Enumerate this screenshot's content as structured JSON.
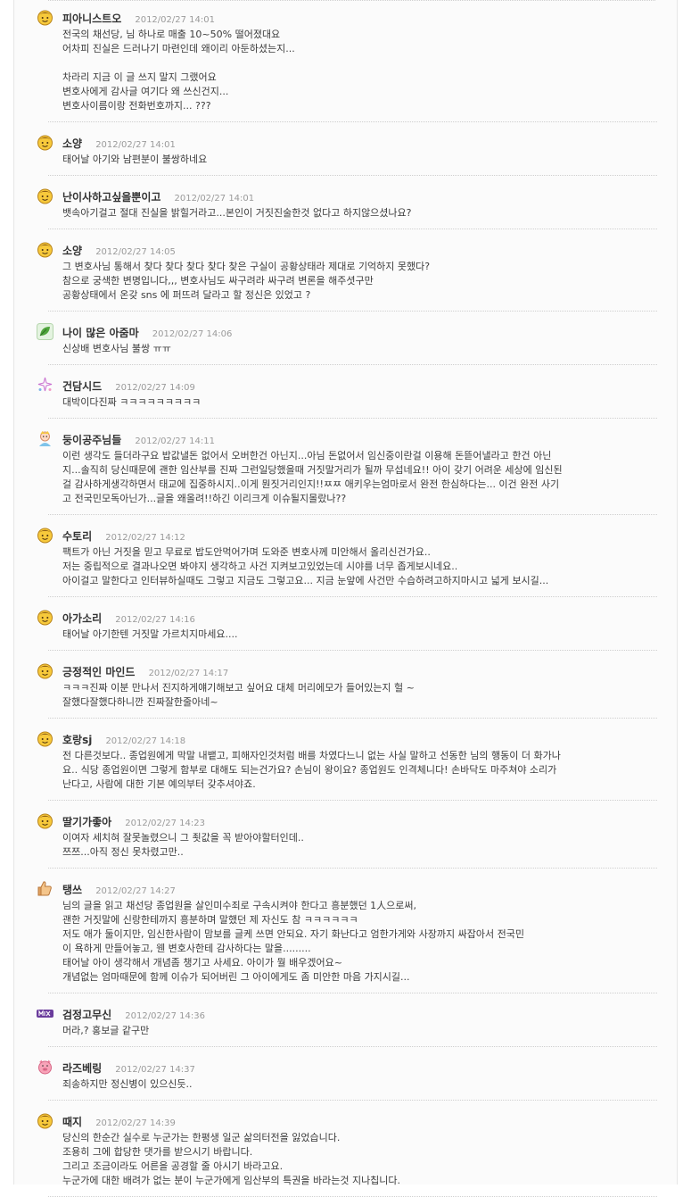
{
  "comments": [
    {
      "avatar": "smiley-face-icon",
      "name": "피아니스트오",
      "date": "2012/02/27 14:01",
      "lines": [
        "전국의 채선당, 님 하나로 매출 10~50% 떨어졌대요",
        "어차피 진실은 드러나기 마련인데 왜이리 아둔하셨는지...",
        "",
        "차라리 지금 이 글 쓰지 말지 그랬어요",
        "변호사에게 감사글 여기다 왜 쓰신건지...",
        "변호사이름이랑 전화번호까지... ???"
      ]
    },
    {
      "avatar": "smiley-face-icon",
      "name": "소양",
      "date": "2012/02/27 14:01",
      "lines": [
        "태어날 아기와 남편분이 불쌍하네요"
      ]
    },
    {
      "avatar": "smiley-face-icon",
      "name": "난이사하고싶을뿐이고",
      "date": "2012/02/27 14:01",
      "lines": [
        "뱃속아기걸고 절대 진실을 밝힐거라고...본인이 거짓진술한것 없다고 하지않으셨나요?"
      ]
    },
    {
      "avatar": "smiley-face-icon",
      "name": "소양",
      "date": "2012/02/27 14:05",
      "lines": [
        "그 변호사님 통해서 찾다 찾다 찾다 찾다 찾은 구실이 공황상태라 제대로 기억하지 못했다?",
        "참으로 궁색한 변명입니다,,, 변호사님도 싸구려라 싸구려 변론을 해주셧구만",
        "공황상태에서 온갖 sns 에 퍼뜨려 달라고 할 정신은 있었고 ?"
      ]
    },
    {
      "avatar": "leaf-icon",
      "name": "나이 많은 아줌마",
      "date": "2012/02/27 14:06",
      "lines": [
        "신상배 변호사님 불쌍 ㅠㅠ"
      ]
    },
    {
      "avatar": "sparkle-icon",
      "name": "건담시드",
      "date": "2012/02/27 14:09",
      "lines": [
        "대박이다진짜 ㅋㅋㅋㅋㅋㅋㅋㅋㅋ"
      ]
    },
    {
      "avatar": "princess-icon",
      "name": "둥이공주님들",
      "date": "2012/02/27 14:11",
      "lines": [
        "이런 생각도 들더라구요 밥값낼돈 없어서 오버한건 아닌지...아님 돈없어서 임신중이란걸 이용해 돈뜯어낼라고 한건 아닌",
        "지...솔직히 당신때문에 괜한 임산부를 진짜 그런일당했을때 거짓말거리가 될까 무섭네요!! 아이 갖기 어려운 세상에 임신된",
        "걸 감사하게생각하면서 태교에 집중하시지..이게 뭔짓거리인지!!ㅉㅉ 애키우는엄마로서 완전 한심하다는... 이건 완전 사기",
        "고 전국민모독아닌가...글을 왜올려!!하긴 이리크게 이슈될지몰랐나??"
      ]
    },
    {
      "avatar": "smiley-face-icon",
      "name": "수토리",
      "date": "2012/02/27 14:12",
      "lines": [
        "팩트가 아닌 거짓을 믿고 무료로 밥도안먹어가며 도와준 변호사께 미안해서 올리신건가요..",
        "저는 중립적으로 결과나오면 봐야지 생각하고 사건 지켜보고있었는데 시야를 너무 좁게보시네요..",
        "아이걸고 말한다고 인터뷰하실때도 그렇고 지금도 그렇고요... 지금 눈앞에 사건만 수습하려고하지마시고 넓게 보시길..."
      ]
    },
    {
      "avatar": "smiley-face-icon",
      "name": "아가소리",
      "date": "2012/02/27 14:16",
      "lines": [
        "태어날 아기한텐 거짓말 가르치지마세요...."
      ]
    },
    {
      "avatar": "smiley-face-icon",
      "name": "긍정적인 마인드",
      "date": "2012/02/27 14:17",
      "lines": [
        "ㅋㅋㅋ진짜 이분 만나서 진지하게얘기해보고 싶어요 대체 머리에모가 들어있는지 헐 ~",
        "잘했다잘했다하니깐 진짜잘한줄아네~"
      ]
    },
    {
      "avatar": "smiley-face-icon",
      "name": "호랑sj",
      "date": "2012/02/27 14:18",
      "lines": [
        "전 다른것보다.. 종업원에게 막말 내뱉고, 피해자인것처럼 배를 차였다느니 없는 사실 말하고 선동한 님의 행동이 더 화가나",
        "요.. 식당 종업원이면 그렇게 함부로 대해도 되는건가요? 손님이 왕이요? 종업원도 인격체니다! 손바닥도 마주쳐야 소리가",
        "난다고, 사람에 대한 기본 예의부터 갖추셔야죠."
      ]
    },
    {
      "avatar": "smiley-face-icon",
      "name": "딸기가좋아",
      "date": "2012/02/27 14:23",
      "lines": [
        "이여자 세치혀 잘못놀렸으니 그 죗값을 꼭 받아야할터인데..",
        "쯔쯔...아직 정신 못차렸고만.."
      ]
    },
    {
      "avatar": "thumbs-up-icon",
      "name": "탱쓰",
      "date": "2012/02/27 14:27",
      "lines": [
        "님의 글을 읽고 채선당 종업원을 살인미수죄로 구속시켜야 한다고 흥분했던 1人으로써,",
        "괜한 거짓말에 신랑한테까지 흥분하며 말했던 제 자신도 참 ㅋㅋㅋㅋㅋㅋ",
        "저도 애가 둘이지만, 임신한사람이 맘보를 글케 쓰면 안되요. 자기 화난다고 엄한가게와 사장까지 싸잡아서 전국민",
        "이 욕하게 만들어놓고, 웬 변호사한테 감사하다는 말을.........",
        "태어날 아이 생각해서 개념좀 챙기고 사세요. 아이가 뭘 배우겠어요~",
        "개념없는 엄마때문에 함께 이슈가 되어버린 그 아이에게도 좀 미안한 마음 가지시길..."
      ]
    },
    {
      "avatar": "mix-badge-icon",
      "name": "검정고무신",
      "date": "2012/02/27 14:36",
      "lines": [
        "머라,? 홍보글 같구만"
      ]
    },
    {
      "avatar": "pig-icon",
      "name": "라즈베링",
      "date": "2012/02/27 14:37",
      "lines": [
        "죄송하지만 정신병이 있으신듯.."
      ]
    },
    {
      "avatar": "smiley-face-icon",
      "name": "때지",
      "date": "2012/02/27 14:39",
      "lines": [
        "당신의 한순간 실수로 누군가는 한평생 일군 삶의터전을 잃었습니다.",
        "조용히 그에 합당한 댓가를 받으시기 바랍니다.",
        "그리고 조금이라도 어른을 공경할 줄 아시기 바라고요.",
        "누군가에 대한 배려가 없는 분이 누군가에게 임산부의 특권을 바라는것 지나칩니다."
      ]
    }
  ]
}
